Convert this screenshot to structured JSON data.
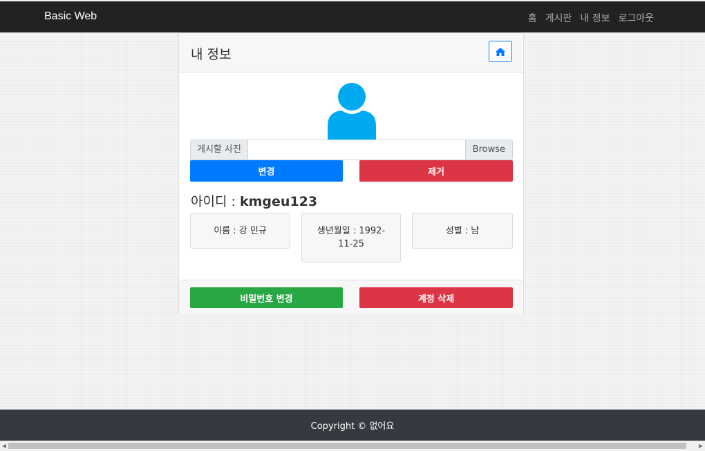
{
  "navbar": {
    "brand": "Basic Web",
    "links": [
      "홈",
      "게시판",
      "내 정보",
      "로그아웃"
    ]
  },
  "card": {
    "title": "내 정보",
    "file": {
      "label": "게시할 사진",
      "browse": "Browse"
    },
    "buttons": {
      "change": "변경",
      "remove": "제거"
    },
    "userid": {
      "label": "아이디 :",
      "value": "kmgeu123"
    },
    "info": {
      "name": "이름 : 강 민규",
      "birth": "생년월일 : 1992-11-25",
      "gender": "성별 : 남"
    },
    "footer_buttons": {
      "change_password": "비밀번호 변경",
      "delete_account": "계정 삭제"
    }
  },
  "footer": {
    "copyright": "Copyright © 없어요"
  },
  "colors": {
    "primary": "#007bff",
    "danger": "#dc3545",
    "success": "#28a745",
    "avatar": "#00aaf0"
  },
  "icons": {
    "home": "home-icon",
    "avatar": "user-avatar-icon"
  }
}
